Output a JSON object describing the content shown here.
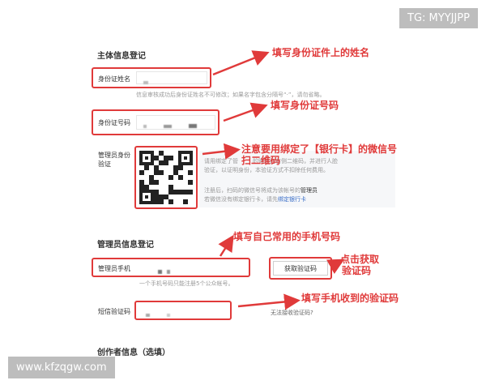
{
  "watermark": {
    "top_right": "TG: MYYJJPP",
    "bottom_left": "www.kfzqgw.com"
  },
  "main_section": {
    "title": "主体信息登记"
  },
  "name_field": {
    "label": "身份证姓名",
    "hint": "信息审核成功后身份证姓名不可修改；如果名字包含分隔号“·”，请勿省略。",
    "annotation": "填写身份证件上的姓名"
  },
  "id_field": {
    "label": "身份证号码",
    "annotation": "填写身份证号码"
  },
  "admin_id": {
    "label_line1": "管理员身份",
    "label_line2": "验证",
    "panel_line1": "请用绑定了管",
    "panel_line1b": "的微信扫右侧二维码，并进行人脸",
    "panel_line2": "验证，以证明身份，本验证方式不扣除任何费用。",
    "panel_line3a": "注册后，扫码的微信号将成为该帐号的",
    "panel_line3b": "管理员",
    "panel_line4a": "若微信没有绑定银行卡，请先",
    "panel_line4b": "绑定银行卡",
    "annotation_line1": "注意要用绑定了【银行卡】的微信号",
    "annotation_line2": "扫二维码"
  },
  "admin_section": {
    "title": "管理员信息登记"
  },
  "phone_field": {
    "label": "管理员手机",
    "hint": "一个手机号码只能注册5个公众帐号。",
    "button": "获取验证码",
    "annotation": "填写自己常用的手机号码",
    "button_annotation_line1": "点击获取",
    "button_annotation_line2": "验证码"
  },
  "sms_field": {
    "label": "短信验证码",
    "no_code_link": "无法接收验证码?",
    "annotation": "填写手机收到的验证码"
  },
  "creator_section": {
    "title": "创作者信息（选填）"
  },
  "colors": {
    "annotation_red": "#e03a3a",
    "link_blue": "#3a6ec7"
  }
}
